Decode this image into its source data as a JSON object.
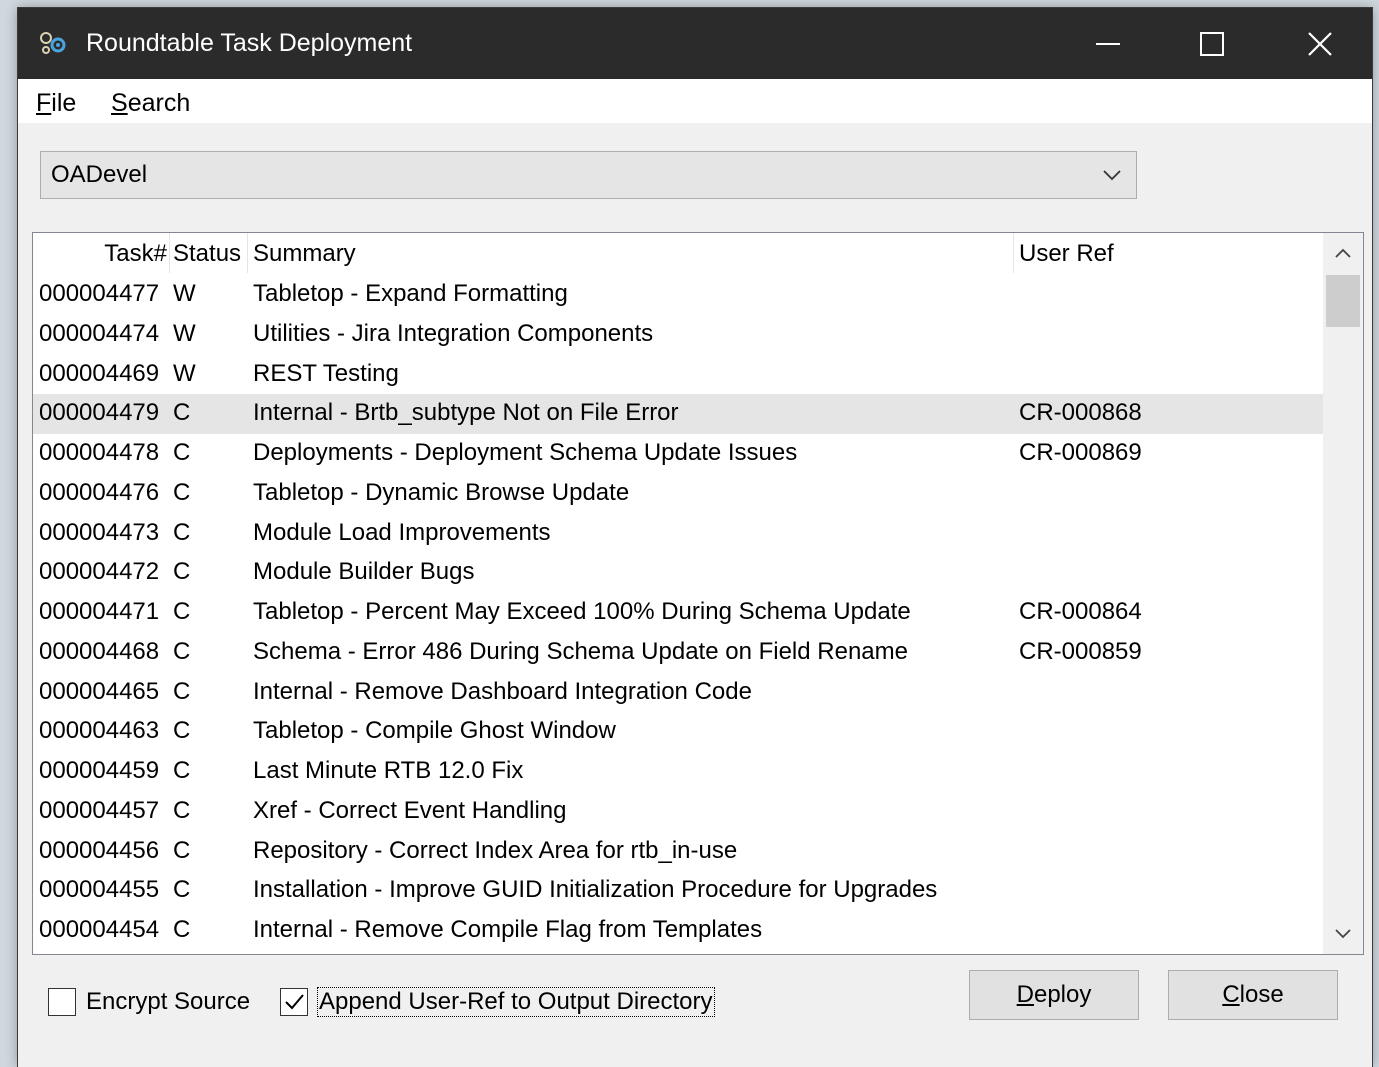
{
  "window": {
    "title": "Roundtable Task Deployment"
  },
  "menu": {
    "file": {
      "mnemonic": "F",
      "rest": "ile"
    },
    "search": {
      "mnemonic": "S",
      "rest": "earch"
    }
  },
  "workspace_selector": {
    "value": "OADevel"
  },
  "task_list": {
    "headers": {
      "task": "Task#",
      "status": "Status",
      "summary": "Summary",
      "user_ref": "User Ref"
    },
    "rows": [
      {
        "task": "000004477",
        "status": "W",
        "summary": "Tabletop - Expand Formatting",
        "user_ref": ""
      },
      {
        "task": "000004474",
        "status": "W",
        "summary": "Utilities - Jira Integration Components",
        "user_ref": ""
      },
      {
        "task": "000004469",
        "status": "W",
        "summary": "REST Testing",
        "user_ref": ""
      },
      {
        "task": "000004479",
        "status": "C",
        "summary": "Internal - Brtb_subtype Not on File Error",
        "user_ref": "CR-000868"
      },
      {
        "task": "000004478",
        "status": "C",
        "summary": "Deployments - Deployment Schema Update Issues",
        "user_ref": "CR-000869"
      },
      {
        "task": "000004476",
        "status": "C",
        "summary": "Tabletop - Dynamic Browse Update",
        "user_ref": ""
      },
      {
        "task": "000004473",
        "status": "C",
        "summary": "Module Load Improvements",
        "user_ref": ""
      },
      {
        "task": "000004472",
        "status": "C",
        "summary": "Module Builder Bugs",
        "user_ref": ""
      },
      {
        "task": "000004471",
        "status": "C",
        "summary": "Tabletop - Percent May Exceed 100% During Schema Update",
        "user_ref": "CR-000864"
      },
      {
        "task": "000004468",
        "status": "C",
        "summary": "Schema - Error 486 During Schema Update on Field Rename",
        "user_ref": "CR-000859"
      },
      {
        "task": "000004465",
        "status": "C",
        "summary": "Internal - Remove Dashboard Integration Code",
        "user_ref": ""
      },
      {
        "task": "000004463",
        "status": "C",
        "summary": "Tabletop - Compile Ghost Window",
        "user_ref": ""
      },
      {
        "task": "000004459",
        "status": "C",
        "summary": "Last Minute RTB 12.0 Fix",
        "user_ref": ""
      },
      {
        "task": "000004457",
        "status": "C",
        "summary": "Xref - Correct Event Handling",
        "user_ref": ""
      },
      {
        "task": "000004456",
        "status": "C",
        "summary": "Repository - Correct Index Area for rtb_in-use",
        "user_ref": ""
      },
      {
        "task": "000004455",
        "status": "C",
        "summary": "Installation - Improve GUID Initialization Procedure for Upgrades",
        "user_ref": ""
      },
      {
        "task": "000004454",
        "status": "C",
        "summary": "Internal - Remove Compile Flag from Templates",
        "user_ref": ""
      }
    ],
    "selected_index": 3
  },
  "options": {
    "encrypt_source": {
      "label": "Encrypt Source",
      "checked": false
    },
    "append_user_ref": {
      "label": "Append User-Ref to Output Directory",
      "checked": true
    }
  },
  "buttons": {
    "deploy": {
      "mnemonic": "D",
      "rest": "eploy"
    },
    "close": {
      "mnemonic": "C",
      "rest": "lose"
    }
  },
  "colors": {
    "titlebar": "#2b2b2b",
    "selected_row": "#e5e5e5",
    "window_bg": "#f0f0f0"
  },
  "icons": {
    "app": "app-gear-icon",
    "minimize": "minimize-icon",
    "maximize": "maximize-icon",
    "close": "close-icon",
    "combo_arrow": "chevron-down-icon",
    "scroll_up": "chevron-up-icon",
    "scroll_down": "chevron-down-icon",
    "check": "checkmark-icon"
  }
}
